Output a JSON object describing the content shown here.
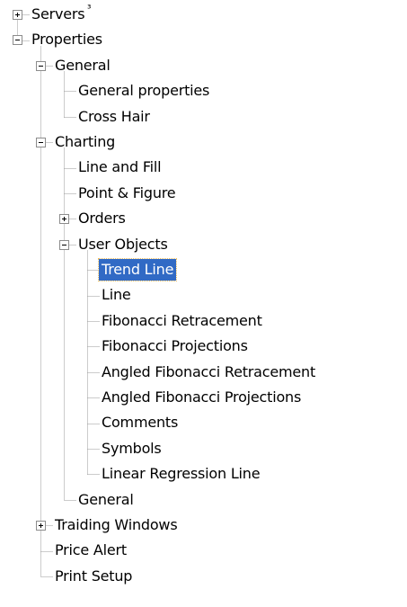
{
  "tree": {
    "nodes": [
      {
        "id": "servers",
        "label": "Servers",
        "depth": 0,
        "toggle": "collapsed",
        "last": false
      },
      {
        "id": "properties",
        "label": "Properties",
        "depth": 0,
        "toggle": "expanded",
        "last": true
      },
      {
        "id": "general-section",
        "label": "General",
        "depth": 1,
        "toggle": "expanded",
        "last": false
      },
      {
        "id": "general-properties",
        "label": "General properties",
        "depth": 2,
        "toggle": "none",
        "last": false
      },
      {
        "id": "cross-hair",
        "label": "Cross Hair",
        "depth": 2,
        "toggle": "none",
        "last": true
      },
      {
        "id": "charting",
        "label": "Charting",
        "depth": 1,
        "toggle": "expanded",
        "last": false
      },
      {
        "id": "line-and-fill",
        "label": "Line and Fill",
        "depth": 2,
        "toggle": "none",
        "last": false
      },
      {
        "id": "point-and-figure",
        "label": "Point & Figure",
        "depth": 2,
        "toggle": "none",
        "last": false
      },
      {
        "id": "orders",
        "label": "Orders",
        "depth": 2,
        "toggle": "collapsed",
        "last": false
      },
      {
        "id": "user-objects",
        "label": "User Objects",
        "depth": 2,
        "toggle": "expanded",
        "last": false
      },
      {
        "id": "trend-line",
        "label": "Trend Line",
        "depth": 3,
        "toggle": "none",
        "last": false,
        "selected": true
      },
      {
        "id": "line",
        "label": "Line",
        "depth": 3,
        "toggle": "none",
        "last": false
      },
      {
        "id": "fibonacci-retracement",
        "label": "Fibonacci Retracement",
        "depth": 3,
        "toggle": "none",
        "last": false
      },
      {
        "id": "fibonacci-projections",
        "label": "Fibonacci Projections",
        "depth": 3,
        "toggle": "none",
        "last": false
      },
      {
        "id": "angled-fibonacci-retracement",
        "label": "Angled Fibonacci Retracement",
        "depth": 3,
        "toggle": "none",
        "last": false
      },
      {
        "id": "angled-fibonacci-projections",
        "label": "Angled Fibonacci Projections",
        "depth": 3,
        "toggle": "none",
        "last": false
      },
      {
        "id": "comments",
        "label": "Comments",
        "depth": 3,
        "toggle": "none",
        "last": false
      },
      {
        "id": "symbols",
        "label": "Symbols",
        "depth": 3,
        "toggle": "none",
        "last": false
      },
      {
        "id": "linear-regression-line",
        "label": "Linear Regression Line",
        "depth": 3,
        "toggle": "none",
        "last": true
      },
      {
        "id": "general-charting",
        "label": "General",
        "depth": 2,
        "toggle": "none",
        "last": true
      },
      {
        "id": "traiding-windows",
        "label": "Traiding Windows",
        "depth": 1,
        "toggle": "collapsed",
        "last": false
      },
      {
        "id": "price-alert",
        "label": "Price Alert",
        "depth": 1,
        "toggle": "none",
        "last": false
      },
      {
        "id": "print-setup",
        "label": "Print Setup",
        "depth": 1,
        "toggle": "none",
        "last": true
      }
    ]
  },
  "colors": {
    "connector": "#9a9a9a",
    "selection": "#316ac5",
    "selection_text": "#ffffff",
    "text": "#000000",
    "toggle_border": "#8c8c8c"
  },
  "icons": {
    "collapsed": "expand-plus-icon",
    "expanded": "collapse-minus-icon"
  },
  "artifact_mark": "³"
}
